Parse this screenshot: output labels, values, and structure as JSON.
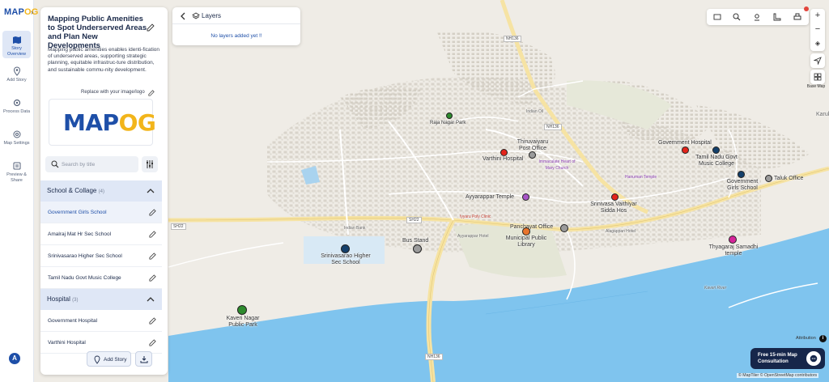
{
  "app": {
    "logo_main": "MAP",
    "logo_accent": "OG"
  },
  "rail": {
    "items": [
      {
        "label": "Story Overview",
        "icon": "map-icon",
        "active": true
      },
      {
        "label": "Add Story",
        "icon": "pin-icon"
      },
      {
        "label": "Process Data",
        "icon": "gear-icon"
      },
      {
        "label": "Map Settings",
        "icon": "settings-icon"
      },
      {
        "label": "Preview & Share",
        "icon": "preview-icon"
      }
    ],
    "avatar": "A"
  },
  "story": {
    "title": "Mapping Public Amenities to Spot Underserved Areas and Plan New Developments",
    "description": "Mapping public amenities enables identi-fication of underserved areas, supporting strategic planning, equitable infrastruc-ture distribution, and sustainable commu-nity development.",
    "replace_label": "Replace with your image/logo",
    "logo_text_main": "MAP",
    "logo_text_accent": "OG",
    "search_placeholder": "Search by title",
    "groups": [
      {
        "name": "School & Collage",
        "count": "(4)",
        "items": [
          "Government Girls School",
          "Amalraj Mat Hr Sec School",
          "Srinivasarao Higher Sec School",
          "Tamil Nadu Govt Music College"
        ]
      },
      {
        "name": "Hospital",
        "count": "(3)",
        "items": [
          "Government Hospital",
          "Varthini Hospital"
        ]
      }
    ],
    "add_story_label": "Add Story"
  },
  "layers": {
    "title": "Layers",
    "empty_text": "No layers added yet !!"
  },
  "map": {
    "basemap_label": "Base Map",
    "attribution_label": "Attribution",
    "consult_label": "Free 15-min Map Consultation",
    "copyright": "© MapTiler © OpenStreetMap contributors",
    "places": {
      "raja_nagar_park": "Raja Nagar Park",
      "thiruvaiyaru_post_office": "Thiruvaiyaru Post Office",
      "varthini_hospital": "Varthini Hospital",
      "government_hospital": "Government Hospital",
      "tn_music_college": "Tamil Nadu Govt Music College",
      "govt_girls_school": "Government Girls School",
      "taluk_office": "Taluk Office",
      "ayyarappar_temple": "Ayyarappar Temple",
      "srinivasa_hospital": "Srinivasa Vaithiyar Sidda Hos",
      "panchayat_office": "Panchayat Office",
      "public_library": "Municipal Public Library",
      "bus_stand": "Bus Stand",
      "srinivasarao_school": "Srinivasarao Higher Sec School",
      "thyagaraj_temple": "Thyagaraj Samadhi temple",
      "kaveri_nagar_park": "Kaveri Nagar Public Park"
    },
    "minor_labels": {
      "indian_oil": "Indian Oil",
      "immaculate_heart": "Immaculate Heart of Mary Church",
      "hanuman_temple": "Hanuman Temple",
      "iyyaru_poly_clinic": "Iyyaru Poly Clinic",
      "ayyarappar_hotel": "Ayyarappar Hotel",
      "alagappan_hotel": "Alagappan Hotel",
      "indian_bank": "Indian Bank",
      "kaveri_river": "Kaveri River",
      "karukudi": "Karukud"
    },
    "roads": {
      "nh136_top": "NH136",
      "nh136_mid": "NH136",
      "nh136_bottom": "NH136",
      "sh22_left": "SH22",
      "sh22_mid": "SH22"
    },
    "colors": {
      "river": "#7fc4ee",
      "hospital": "#e3241b",
      "school": "#14406b",
      "park": "#2e8b2e",
      "temple": "#a855c7",
      "office": "#9b9b9b",
      "library": "#e8742c",
      "pink": "#d6249a"
    }
  }
}
